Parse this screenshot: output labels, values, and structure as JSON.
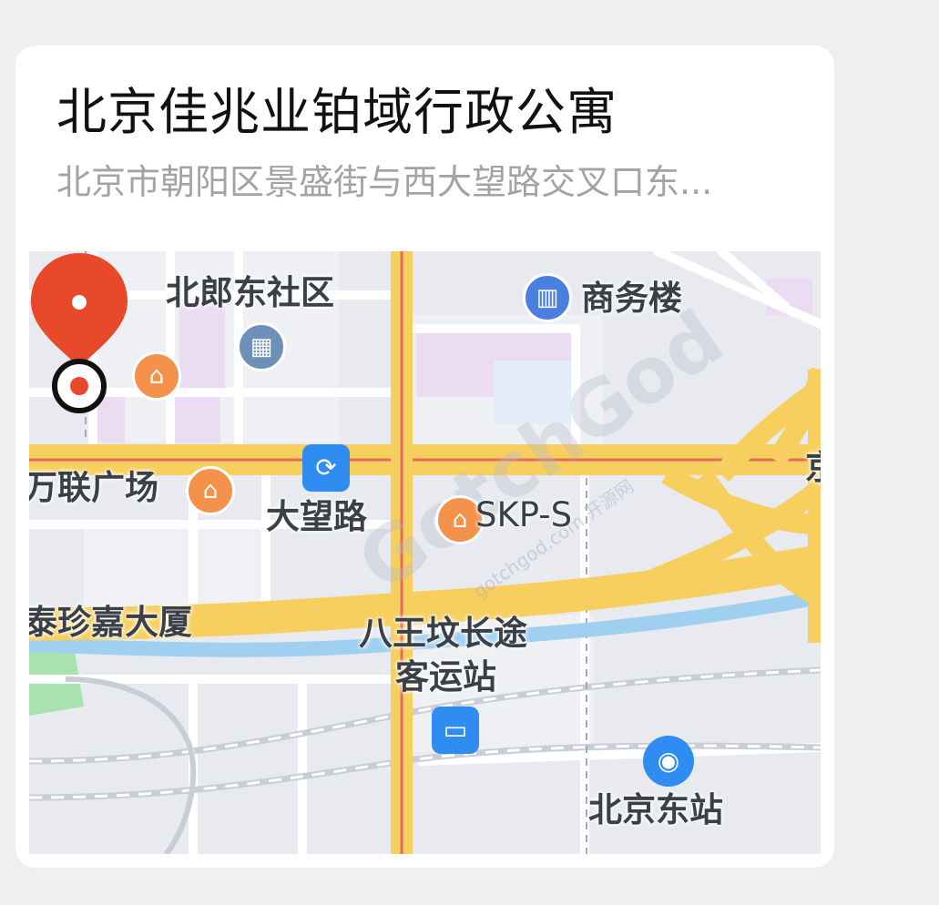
{
  "title": "北京佳兆业铂域行政公寓",
  "address": "北京市朝阳区景盛街与西大望路交叉口东...",
  "map": {
    "labels": {
      "beilang": "北郎东社区",
      "shangwu": "商务楼",
      "wanlian": "万联广场",
      "dawang_road": "大望路",
      "skp": "SKP-S",
      "zhenjia": "泰珍嘉大厦",
      "bawangfen_1": "八王坟长途",
      "bawangfen_2": "客运站",
      "beijing_east": "北京东站",
      "edge_char": "京"
    },
    "watermark": {
      "text": "GotchGod",
      "url": "gotchgod.com 开源网"
    },
    "icons": {
      "community": "building-icon",
      "office": "office-building-icon",
      "shop_1": "shopping-bag-icon",
      "shop_2": "shopping-bag-icon",
      "shop_3": "shopping-bag-icon",
      "subway": "subway-transfer-icon",
      "bus": "bus-icon",
      "train": "train-station-icon"
    },
    "colors": {
      "pin": "#e8492b",
      "road_main": "#f7cf5e",
      "road_red": "#e46b5c",
      "water": "#9fd0f0",
      "block": "#e8eaef"
    }
  }
}
